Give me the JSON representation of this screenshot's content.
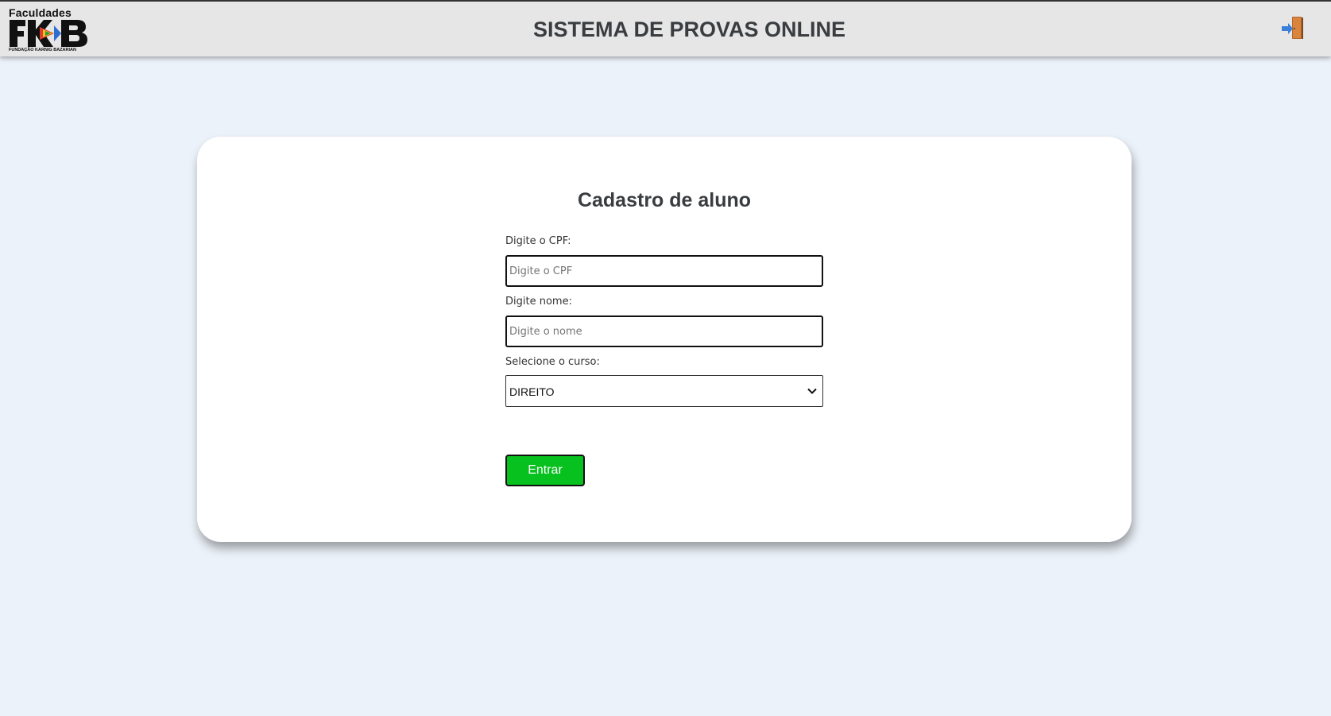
{
  "header": {
    "logo": {
      "top_text": "Faculdades",
      "mark_text": "FKB",
      "bottom_text": "FUNDAÇÃO KARNIG BAZARIAN"
    },
    "title": "SISTEMA DE PROVAS ONLINE",
    "logout_icon": "exit-door-icon"
  },
  "form": {
    "title": "Cadastro de aluno",
    "cpf": {
      "label": "Digite o CPF:",
      "placeholder": "Digite o CPF",
      "value": ""
    },
    "nome": {
      "label": "Digite nome:",
      "placeholder": "Digite o nome",
      "value": ""
    },
    "curso": {
      "label": "Selecione o curso:",
      "selected": "DIREITO"
    },
    "submit_label": "Entrar"
  },
  "colors": {
    "background": "#ecf2f9",
    "header": "#e6e6e6",
    "button": "#06c11e",
    "title_text": "#3a3d40"
  }
}
